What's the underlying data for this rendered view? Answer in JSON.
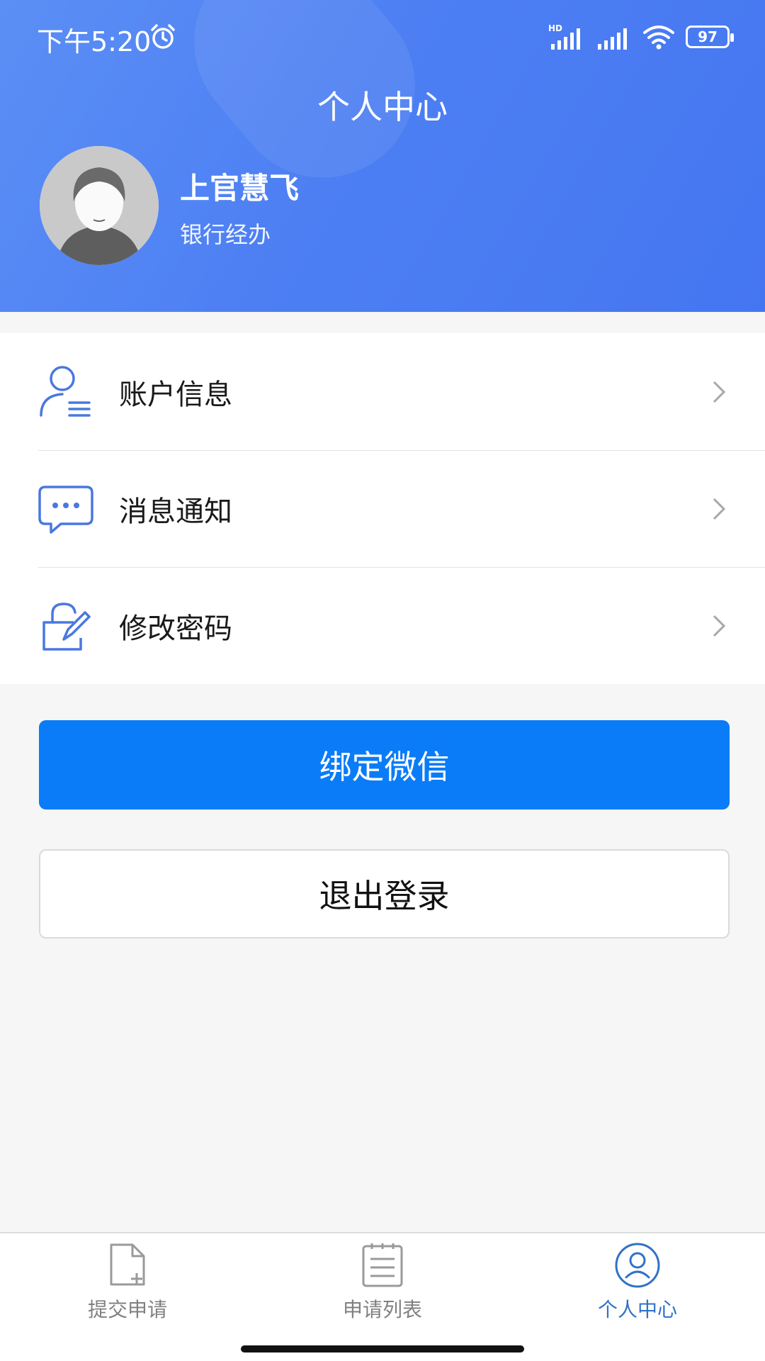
{
  "status_bar": {
    "time": "下午5:20",
    "network_label": "HD",
    "battery": "97",
    "icons": [
      "alarm-icon",
      "signal-icon",
      "signal-icon",
      "wifi-icon",
      "battery-icon"
    ]
  },
  "header": {
    "title": "个人中心",
    "user_name": "上官慧飞",
    "user_role": "银行经办"
  },
  "menu": {
    "items": [
      {
        "label": "账户信息",
        "icon": "account-info-icon"
      },
      {
        "label": "消息通知",
        "icon": "message-icon"
      },
      {
        "label": "修改密码",
        "icon": "lock-edit-icon"
      }
    ]
  },
  "actions": {
    "bind_wechat": "绑定微信",
    "logout": "退出登录"
  },
  "tabbar": {
    "tabs": [
      {
        "label": "提交申请",
        "icon": "document-add-icon",
        "active": false
      },
      {
        "label": "申请列表",
        "icon": "list-icon",
        "active": false
      },
      {
        "label": "个人中心",
        "icon": "user-circle-icon",
        "active": true
      }
    ]
  },
  "colors": {
    "header": "#4d7ff3",
    "primary_button": "#0a7cf8",
    "icon_blue": "#4a78e0",
    "tab_active": "#2f72c7",
    "tab_inactive": "#808080"
  }
}
